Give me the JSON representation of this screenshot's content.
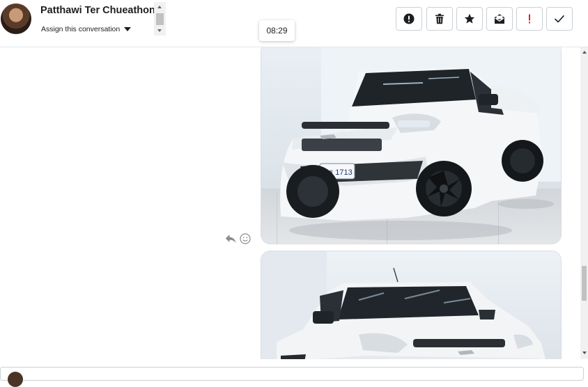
{
  "conversation": {
    "contact_name": "Patthawi Ter Chueathong",
    "assign_label": "Assign this conversation",
    "hover_time": "08:29"
  },
  "toolbar": {
    "buttons": [
      {
        "name": "mark-spam-button",
        "icon": "exclamation-circle-icon"
      },
      {
        "name": "delete-button",
        "icon": "trash-icon"
      },
      {
        "name": "star-button",
        "icon": "star-icon"
      },
      {
        "name": "mark-unread-button",
        "icon": "envelope-icon"
      },
      {
        "name": "mark-important-button",
        "icon": "exclamation-icon",
        "color": "#e02424"
      },
      {
        "name": "mark-done-button",
        "icon": "checkmark-icon"
      }
    ]
  },
  "messages": [
    {
      "type": "image",
      "subject": "white pickup truck, front-left view, plate",
      "plate": "ฒฐ 1713"
    },
    {
      "type": "image",
      "subject": "white pickup truck, front-right view"
    }
  ],
  "message_actions": [
    "reply-icon",
    "emoji-reaction-icon"
  ],
  "colors": {
    "border": "#ccd0d5",
    "important": "#e02424",
    "text": "#1c1e21"
  }
}
